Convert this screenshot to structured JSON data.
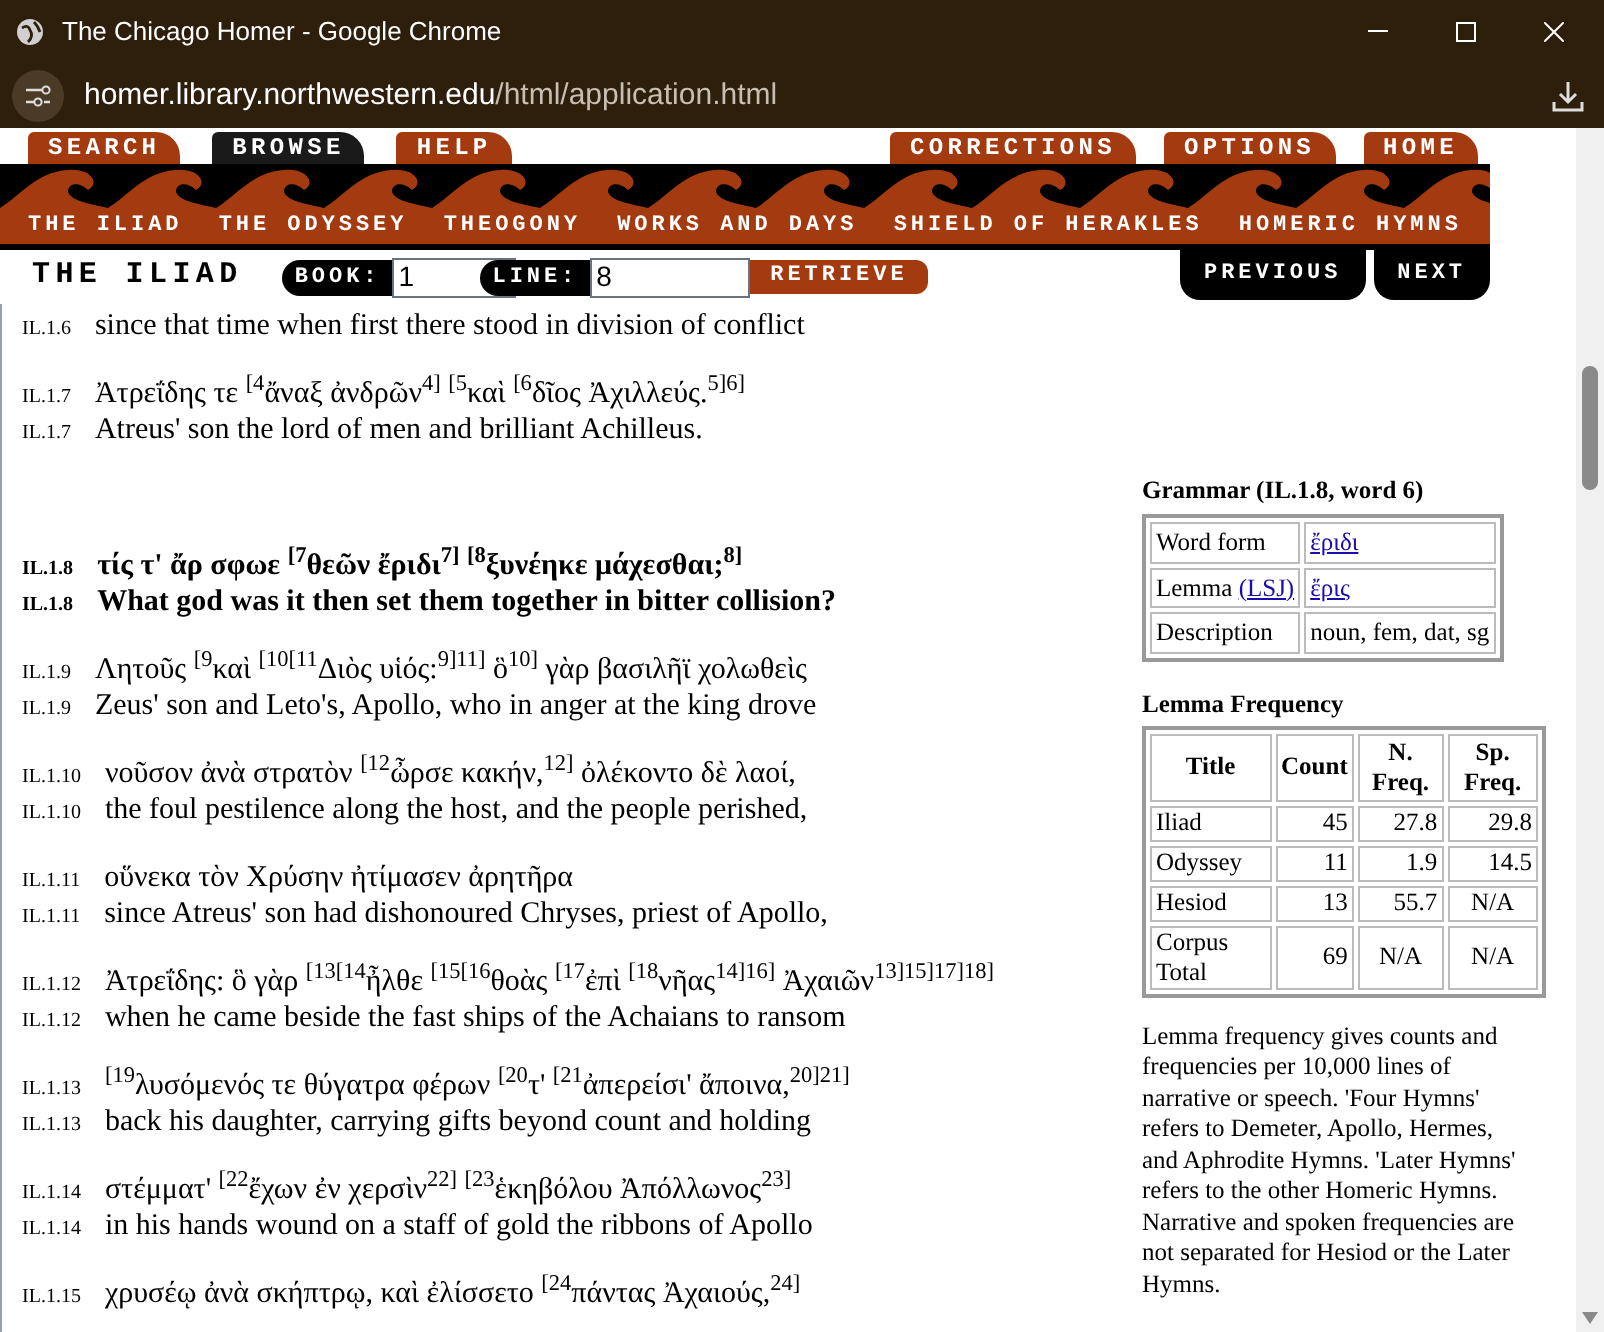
{
  "browser": {
    "title": "The Chicago Homer - Google Chrome",
    "url_host": "homer.library.northwestern.edu",
    "url_path": "/html/application.html"
  },
  "menu": {
    "left": [
      {
        "label": "SEARCH",
        "selected": false
      },
      {
        "label": "BROWSE",
        "selected": true
      },
      {
        "label": "HELP",
        "selected": false
      }
    ],
    "right": [
      {
        "label": "CORRECTIONS",
        "selected": false
      },
      {
        "label": "OPTIONS",
        "selected": false
      },
      {
        "label": "HOME",
        "selected": false
      }
    ]
  },
  "works": [
    "THE ILIAD",
    "THE ODYSSEY",
    "THEOGONY",
    "WORKS AND DAYS",
    "SHIELD OF HERAKLES",
    "HOMERIC HYMNS"
  ],
  "browse_bar": {
    "title": "THE ILIAD",
    "book_label": "BOOK:",
    "book": "1",
    "line_label": "LINE:",
    "line": "8",
    "retrieve": "RETRIEVE",
    "previous": "PREVIOUS",
    "next": "NEXT"
  },
  "verses": [
    {
      "english_ref": "IL.1.6",
      "english": "since that time when first there stood in division of conflict",
      "selected": false
    },
    {
      "greek_ref": "IL.1.7",
      "english_ref": "IL.1.7",
      "greek": "Ἀτρεΐδης τε $^{[4}$ἄναξ ἀνδρῶν$^{4]}$ $^{[5}$καὶ $^{[6}$δῖος Ἀχιλλεύς.$^{5]6]}$",
      "english": "Atreus' son the lord of men and brilliant Achilleus.",
      "selected": false
    },
    {
      "greek_ref": "IL.1.8",
      "english_ref": "IL.1.8",
      "greek": "τίς τ' ἄρ σφωε $^{[7}$θεῶν ἔριδι$^{7]}$ $^{[8}$ξυνέηκε μάχεσθαι;$^{8]}$",
      "english": "What god was it then set them together in bitter collision?",
      "selected": true
    },
    {
      "greek_ref": "IL.1.9",
      "english_ref": "IL.1.9",
      "greek": "Λητοῦς $^{[9}$καὶ $^{[10[11}$Διὸς υἱός:$^{9]11]}$ ὃ$^{10]}$ γὰρ βασιλῆϊ χολωθεὶς",
      "english": "Zeus' son and Leto's, Apollo, who in anger at the king drove",
      "selected": false
    },
    {
      "greek_ref": "IL.1.10",
      "english_ref": "IL.1.10",
      "greek": "νοῦσον ἀνὰ στρατὸν $^{[12}$ὦρσε κακήν,$^{12]}$ ὀλέκοντο δὲ λαοί,",
      "english": "the foul pestilence along the host, and the people perished,",
      "selected": false
    },
    {
      "greek_ref": "IL.1.11",
      "english_ref": "IL.1.11",
      "greek": "οὕνεκα τὸν Χρύσην ἠτίμασεν ἀρητῆρα",
      "english": "since Atreus' son had dishonoured Chryses, priest of Apollo,",
      "selected": false
    },
    {
      "greek_ref": "IL.1.12",
      "english_ref": "IL.1.12",
      "greek": "Ἀτρεΐδης: ὃ γὰρ $^{[13[14}$ἦλθε $^{[15[16}$θοὰς $^{[17}$ἐπὶ $^{[18}$νῆας$^{14]16]}$ Ἀχαιῶν$^{13]15]17]18]}$",
      "english": "when he came beside the fast ships of the Achaians to ransom",
      "selected": false
    },
    {
      "greek_ref": "IL.1.13",
      "english_ref": "IL.1.13",
      "greek": "$^{[19}$λυσόμενός τε θύγατρα φέρων $^{[20}$τ' $^{[21}$ἀπερείσι' ἄποινα,$^{20]21]}$",
      "english": "back his daughter, carrying gifts beyond count and holding",
      "selected": false
    },
    {
      "greek_ref": "IL.1.14",
      "english_ref": "IL.1.14",
      "greek": "στέμματ' $^{[22}$ἔχων ἐν χερσὶν$^{22]}$ $^{[23}$ἑκηβόλου Ἀπόλλωνος$^{23]}$",
      "english": "in his hands wound on a staff of gold the ribbons of Apollo",
      "selected": false
    },
    {
      "greek_ref": "IL.1.15",
      "greek": "χρυσέῳ ἀνὰ σκήπτρῳ, καὶ ἐλίσσετο $^{[24}$πάντας Ἀχαιούς,$^{24]}$",
      "selected": false
    }
  ],
  "grammar": {
    "title": "Grammar (IL.1.8, word 6)",
    "rows": [
      {
        "label": "Word form",
        "value": "ἔριδι",
        "link": true
      },
      {
        "label": "Lemma",
        "label_link": "(LSJ)",
        "value": "ἔρις",
        "link": true
      },
      {
        "label": "Description",
        "value": "noun, fem, dat, sg",
        "link": false
      }
    ]
  },
  "frequency": {
    "title": "Lemma Frequency",
    "columns": [
      "Title",
      "Count",
      "N. Freq.",
      "Sp. Freq."
    ],
    "rows": [
      [
        "Iliad",
        "45",
        "27.8",
        "29.8"
      ],
      [
        "Odyssey",
        "11",
        "1.9",
        "14.5"
      ],
      [
        "Hesiod",
        "13",
        "55.7",
        "N/A"
      ],
      [
        "Corpus Total",
        "69",
        "N/A",
        "N/A"
      ]
    ]
  },
  "note": "Lemma frequency gives counts and frequencies per 10,000 lines of narrative or speech. 'Four Hymns' refers to Demeter, Apollo, Hermes, and Aphrodite Hymns. 'Later Hymns' refers to the other Homeric Hymns. Narrative and spoken frequencies are not separated for Hesiod or the Later Hymns."
}
